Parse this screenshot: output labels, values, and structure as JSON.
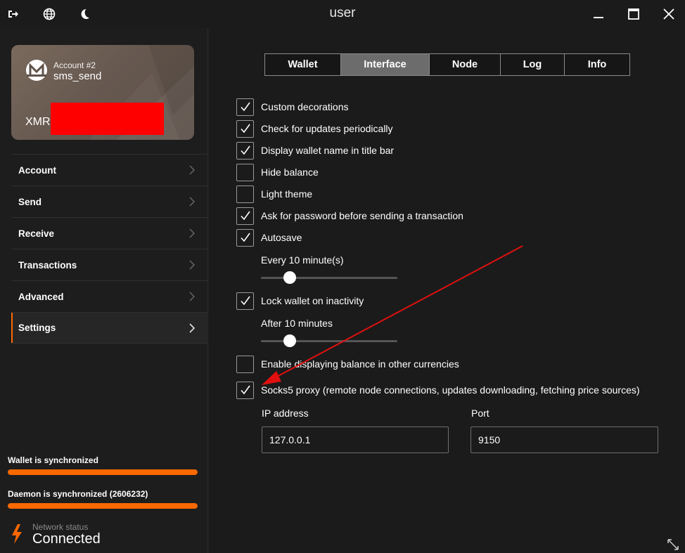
{
  "window": {
    "title": "user",
    "icons": [
      "exit-icon",
      "globe-icon",
      "moon-icon",
      "minimize-icon",
      "maximize-icon",
      "close-icon"
    ]
  },
  "account_card": {
    "account_label": "Account #2",
    "account_name": "sms_send",
    "currency": "XMR",
    "logo": "monero-logo-icon"
  },
  "sidebar": {
    "items": [
      {
        "label": "Account"
      },
      {
        "label": "Send"
      },
      {
        "label": "Receive"
      },
      {
        "label": "Transactions"
      },
      {
        "label": "Advanced"
      },
      {
        "label": "Settings",
        "active": true
      }
    ]
  },
  "status": {
    "wallet_sync_label": "Wallet is synchronized",
    "wallet_sync_progress": 1.0,
    "daemon_sync_label": "Daemon is synchronized (2606232)",
    "daemon_sync_progress": 1.0,
    "network_label": "Network status",
    "network_value": "Connected"
  },
  "tabs": [
    {
      "label": "Wallet"
    },
    {
      "label": "Interface",
      "active": true
    },
    {
      "label": "Node"
    },
    {
      "label": "Log"
    },
    {
      "label": "Info"
    }
  ],
  "settings": {
    "custom_decorations": {
      "label": "Custom decorations",
      "checked": true
    },
    "check_updates": {
      "label": "Check for updates periodically",
      "checked": true
    },
    "display_wallet_name": {
      "label": "Display wallet name in title bar",
      "checked": true
    },
    "hide_balance": {
      "label": "Hide balance",
      "checked": false
    },
    "light_theme": {
      "label": "Light theme",
      "checked": false
    },
    "ask_password": {
      "label": "Ask for password before sending a transaction",
      "checked": true
    },
    "autosave": {
      "label": "Autosave",
      "checked": true
    },
    "autosave_interval_label": "Every 10 minute(s)",
    "autosave_slider_fraction": 0.18,
    "lock_wallet": {
      "label": "Lock wallet on inactivity",
      "checked": true
    },
    "lock_after_label": "After 10 minutes",
    "lock_slider_fraction": 0.18,
    "balance_other_currencies": {
      "label": "Enable displaying balance in other currencies",
      "checked": false
    },
    "socks5_proxy": {
      "label": "Socks5 proxy (remote node connections, updates downloading, fetching price sources)",
      "checked": true
    },
    "ip_label": "IP address",
    "ip_value": "127.0.0.1",
    "port_label": "Port",
    "port_value": "9150"
  },
  "colors": {
    "accent": "#fa6800",
    "annotation_arrow": "#e01010",
    "redaction": "#ff0000"
  }
}
